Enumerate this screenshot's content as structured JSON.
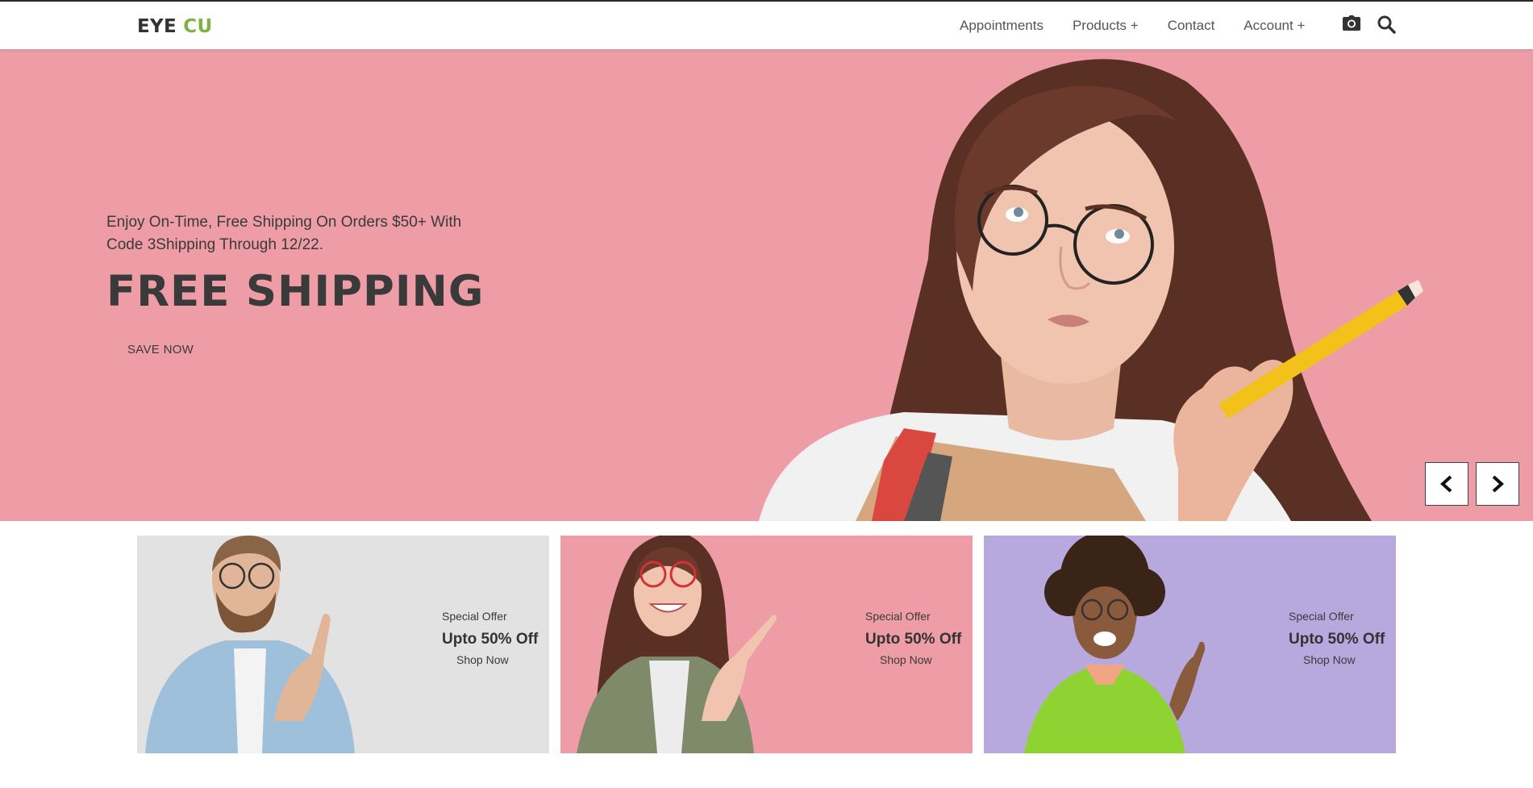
{
  "header": {
    "logo_part1": "EYE",
    "logo_part2": "CU",
    "nav": [
      {
        "label": "Appointments"
      },
      {
        "label": "Products +"
      },
      {
        "label": "Contact"
      },
      {
        "label": "Account +"
      }
    ],
    "icons": [
      "camera-icon",
      "search-icon"
    ]
  },
  "hero": {
    "subtitle": "Enjoy On-Time, Free Shipping On Orders $50+ With Code 3Shipping Through 12/22.",
    "title": "FREE SHIPPING",
    "cta": "SAVE NOW",
    "background": "#ee9da6"
  },
  "offers": [
    {
      "small": "Special Offer",
      "big": "Upto 50% Off",
      "link": "Shop Now",
      "background": "#e2e2e2"
    },
    {
      "small": "Special Offer",
      "big": "Upto 50% Off",
      "link": "Shop Now",
      "background": "#ee9da6"
    },
    {
      "small": "Special Offer",
      "big": "Upto 50% Off",
      "link": "Shop Now",
      "background": "#b7a9dd"
    }
  ],
  "colors": {
    "accent": "#7cb342",
    "text": "#333333"
  }
}
